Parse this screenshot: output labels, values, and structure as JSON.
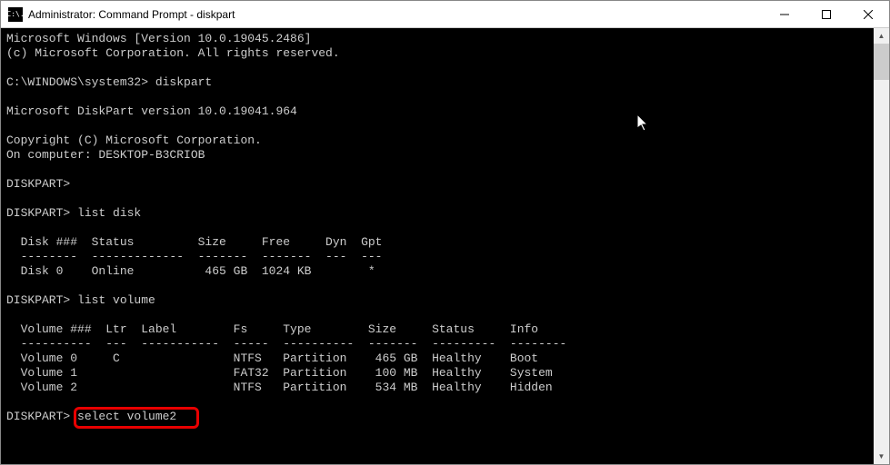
{
  "title": "Administrator: Command Prompt - diskpart",
  "icon_label": "C:\\.",
  "header": {
    "line1": "Microsoft Windows [Version 10.0.19045.2486]",
    "line2": "(c) Microsoft Corporation. All rights reserved."
  },
  "prompt_initial": "C:\\WINDOWS\\system32> diskpart",
  "diskpart_version": "Microsoft DiskPart version 10.0.19041.964",
  "copyright": "Copyright (C) Microsoft Corporation.",
  "computer": "On computer: DESKTOP-B3CRIOB",
  "prompt_blank": "DISKPART>",
  "cmd_list_disk": "DISKPART> list disk",
  "disk_header": "  Disk ###  Status         Size     Free     Dyn  Gpt",
  "disk_divider": "  --------  -------------  -------  -------  ---  ---",
  "disk_row0": "  Disk 0    Online          465 GB  1024 KB        *",
  "cmd_list_volume": "DISKPART> list volume",
  "vol_header": "  Volume ###  Ltr  Label        Fs     Type        Size     Status     Info",
  "vol_divider": "  ----------  ---  -----------  -----  ----------  -------  ---------  --------",
  "vol_row0": "  Volume 0     C                NTFS   Partition    465 GB  Healthy    Boot",
  "vol_row1": "  Volume 1                      FAT32  Partition    100 MB  Healthy    System",
  "vol_row2": "  Volume 2                      NTFS   Partition    534 MB  Healthy    Hidden",
  "cmd_select": "DISKPART> select volume2",
  "chart_data": {
    "type": "table",
    "disks": [
      {
        "disk": "Disk 0",
        "status": "Online",
        "size": "465 GB",
        "free": "1024 KB",
        "dyn": "",
        "gpt": "*"
      }
    ],
    "volumes": [
      {
        "volume": "Volume 0",
        "ltr": "C",
        "label": "",
        "fs": "NTFS",
        "type": "Partition",
        "size": "465 GB",
        "status": "Healthy",
        "info": "Boot"
      },
      {
        "volume": "Volume 1",
        "ltr": "",
        "label": "",
        "fs": "FAT32",
        "type": "Partition",
        "size": "100 MB",
        "status": "Healthy",
        "info": "System"
      },
      {
        "volume": "Volume 2",
        "ltr": "",
        "label": "",
        "fs": "NTFS",
        "type": "Partition",
        "size": "534 MB",
        "status": "Healthy",
        "info": "Hidden"
      }
    ]
  }
}
